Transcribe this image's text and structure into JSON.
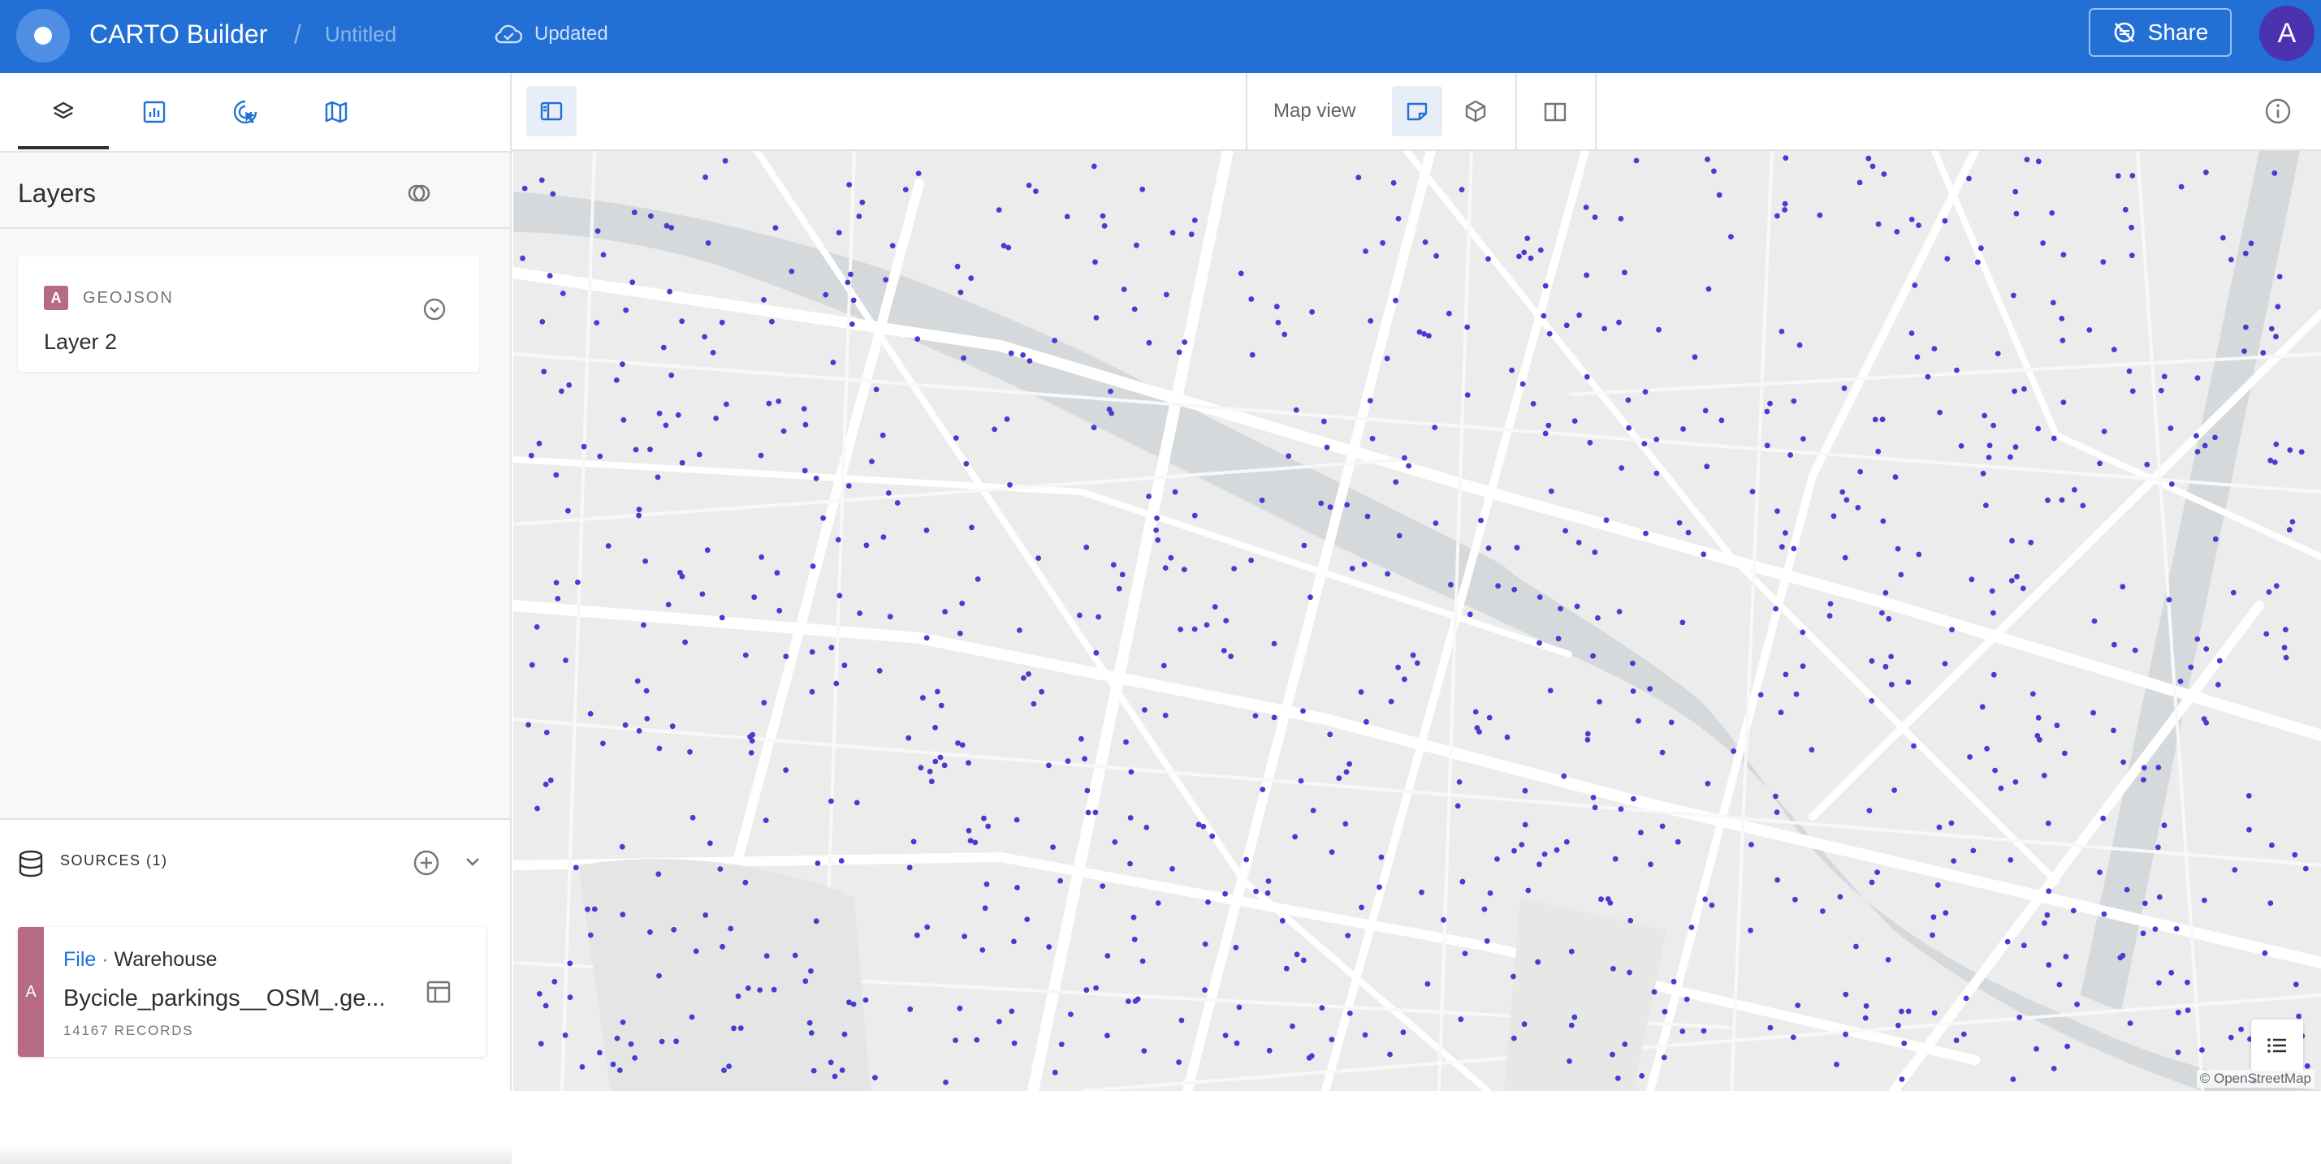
{
  "header": {
    "app_title": "CARTO Builder",
    "separator": "/",
    "document_title": "Untitled",
    "status": "Updated",
    "share_label": "Share",
    "avatar_initial": "A"
  },
  "left_panel": {
    "tabs": [
      {
        "name": "layers",
        "icon": "layers-icon"
      },
      {
        "name": "widgets",
        "icon": "chart-icon"
      },
      {
        "name": "interactions",
        "icon": "cursor-click-icon"
      },
      {
        "name": "basemaps",
        "icon": "map-icon"
      }
    ],
    "active_tab": "layers",
    "layers_title": "Layers",
    "layers": [
      {
        "badge": "A",
        "type": "GEOJSON",
        "name": "Layer 2",
        "badge_color": "#b76a84"
      }
    ],
    "sources": {
      "title": "SOURCES (1)",
      "items": [
        {
          "badge": "A",
          "kind": "File",
          "separator": "·",
          "location": "Warehouse",
          "name": "Bycicle_parkings__OSM_.ge...",
          "records": "14167 RECORDS"
        }
      ]
    }
  },
  "map_toolbar": {
    "map_view_label": "Map view",
    "views": [
      "2d-view-icon",
      "3d-view-icon",
      "split-view-icon"
    ],
    "active_view": "2d-view-icon"
  },
  "map": {
    "attribution": "© OpenStreetMap",
    "point_color": "#4b3ad1",
    "water_color": "#d5d9db",
    "road_color": "#ffffff",
    "background_color": "#ececec"
  },
  "colors": {
    "topbar": "#2270d6",
    "avatar": "#4a32b0",
    "layer_badge": "#b76a84",
    "link": "#2270d6"
  }
}
